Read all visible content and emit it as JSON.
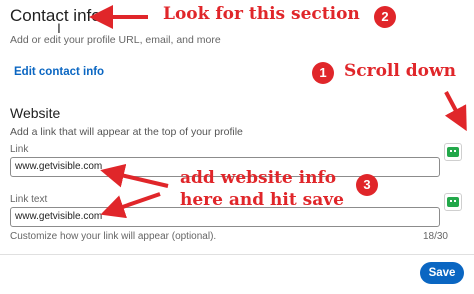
{
  "contact": {
    "title": "Contact info",
    "subtitle": "Add or edit your profile URL, email, and more",
    "edit_link": "Edit contact info"
  },
  "website": {
    "title": "Website",
    "subtitle": "Add a link that will appear at the top of your profile",
    "link_label": "Link",
    "link_value": "www.getvisible.com",
    "link_text_label": "Link text",
    "link_text_value": "www.getvisible.com",
    "hint": "Customize how your link will appear (optional).",
    "counter": "18/30"
  },
  "footer": {
    "save_label": "Save"
  },
  "annotations": {
    "look_label": "Look for this section",
    "look_num": "2",
    "scroll_label": "Scroll down",
    "scroll_num": "1",
    "add_line1": "add website info",
    "add_line2": "here and hit save",
    "add_num": "3"
  },
  "colors": {
    "accent": "#0a66c2",
    "annotation": "#e0262a",
    "fill_icon": "#22a84a"
  },
  "icons": {
    "autofill": "autofill-icon",
    "cursor": "text-cursor-icon"
  }
}
